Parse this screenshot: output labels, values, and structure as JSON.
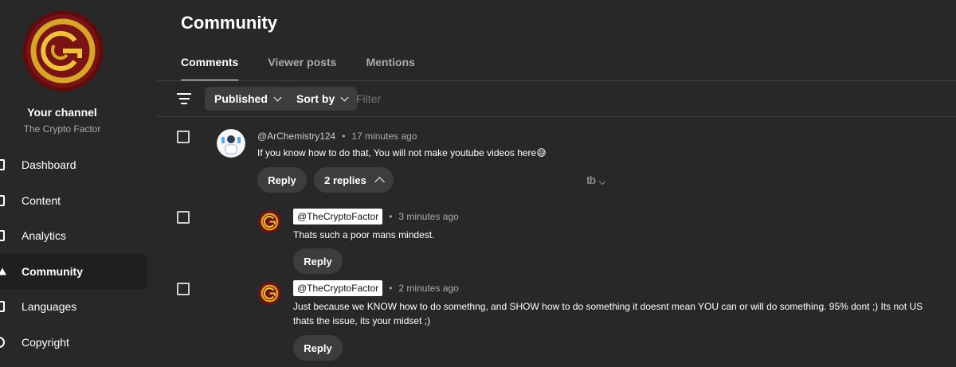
{
  "sidebar": {
    "channel_title": "Your channel",
    "channel_name": "The Crypto Factor",
    "items": [
      {
        "label": "Dashboard",
        "icon": "dashboard-icon"
      },
      {
        "label": "Content",
        "icon": "content-icon"
      },
      {
        "label": "Analytics",
        "icon": "analytics-icon"
      },
      {
        "label": "Community",
        "icon": "community-icon",
        "active": true
      },
      {
        "label": "Languages",
        "icon": "languages-icon"
      },
      {
        "label": "Copyright",
        "icon": "copyright-icon"
      }
    ]
  },
  "page": {
    "title": "Community",
    "tabs": [
      {
        "label": "Comments",
        "active": true
      },
      {
        "label": "Viewer posts"
      },
      {
        "label": "Mentions"
      }
    ]
  },
  "filters": {
    "published": "Published",
    "sort_by": "Sort by",
    "placeholder": "Filter"
  },
  "comments": [
    {
      "author": "@ArChemistry124",
      "time": "17 minutes ago",
      "text": "If you know how to do that, You will not make youtube videos here😅",
      "reply_label": "Reply",
      "replies_label": "2 replies",
      "replies": [
        {
          "author": "@TheCryptoFactor",
          "time": "3 minutes ago",
          "text": "Thats such a poor mans mindest.",
          "reply_label": "Reply"
        },
        {
          "author": "@TheCryptoFactor",
          "time": "2 minutes ago",
          "text_line1": "Just because we KNOW how to do somethng, and SHOW how to do something it doesnt mean YOU can or will do something. 95% dont ;) Its not US",
          "text_line2": "thats the issue, its your midset ;)",
          "reply_label": "Reply"
        }
      ]
    }
  ],
  "colors": {
    "background": "#282828",
    "chip": "#3d3d3d",
    "secondary_text": "#aaaaaa",
    "logo_gold": "#d8a42a",
    "logo_red": "#7a1414"
  }
}
